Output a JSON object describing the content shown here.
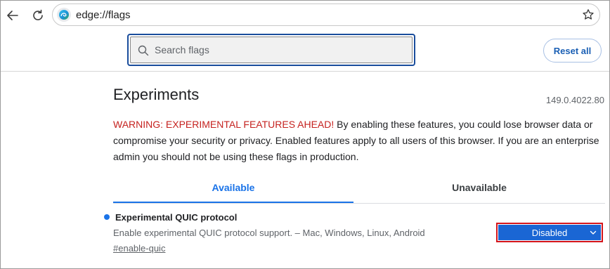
{
  "browser": {
    "url": "edge://flags"
  },
  "header": {
    "search_placeholder": "Search flags",
    "reset_label": "Reset all"
  },
  "main": {
    "title": "Experiments",
    "version": "149.0.4022.80",
    "warning_prefix": "WARNING: EXPERIMENTAL FEATURES AHEAD!",
    "warning_body": " By enabling these features, you could lose browser data or compromise your security or privacy. Enabled features apply to all users of this browser. If you are an enterprise admin you should not be using these flags in production.",
    "tabs": [
      {
        "label": "Available",
        "active": true
      },
      {
        "label": "Unavailable",
        "active": false
      }
    ]
  },
  "experiment": {
    "name": "Experimental QUIC protocol",
    "description": "Enable experimental QUIC protocol support. – Mac, Windows, Linux, Android",
    "tag": "#enable-quic",
    "selected_value": "Disabled"
  },
  "colors": {
    "accent": "#1a73e8",
    "warning": "#c5221f",
    "select_bg": "#1a66d4",
    "highlight": "#d4151b"
  }
}
